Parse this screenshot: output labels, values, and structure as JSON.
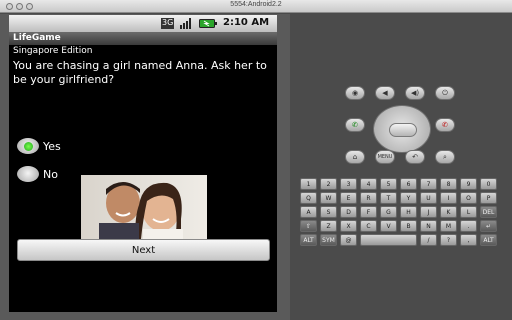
{
  "window": {
    "title": "5554:Android2.2"
  },
  "statusbar": {
    "network": "3G",
    "time": "2:10 AM"
  },
  "app": {
    "title": "LifeGame",
    "edition": "Singapore Edition",
    "question": "You are chasing a girl named Anna. Ask her to be your girlfriend?",
    "options": [
      {
        "label": "Yes",
        "selected": true
      },
      {
        "label": "No",
        "selected": false
      }
    ],
    "next_label": "Next"
  },
  "keyboard": {
    "row1": [
      "1",
      "2",
      "3",
      "4",
      "5",
      "6",
      "7",
      "8",
      "9",
      "0"
    ],
    "row1_sub": [
      "Q",
      "W",
      "E",
      "R",
      "T",
      "Y",
      "U",
      "I",
      "O",
      "P"
    ],
    "row2": [
      "A",
      "S",
      "D",
      "F",
      "G",
      "H",
      "J",
      "K",
      "L",
      "DEL"
    ],
    "row3": [
      "Z",
      "X",
      "C",
      "V",
      "B",
      "N",
      "M",
      ".",
      "↵"
    ],
    "row4": [
      "ALT",
      "SYM",
      "@",
      "",
      "/",
      "?",
      ",",
      "ALT"
    ]
  },
  "colors": {
    "radio_selected": "#1fa51f",
    "screen_bg": "#000000"
  }
}
